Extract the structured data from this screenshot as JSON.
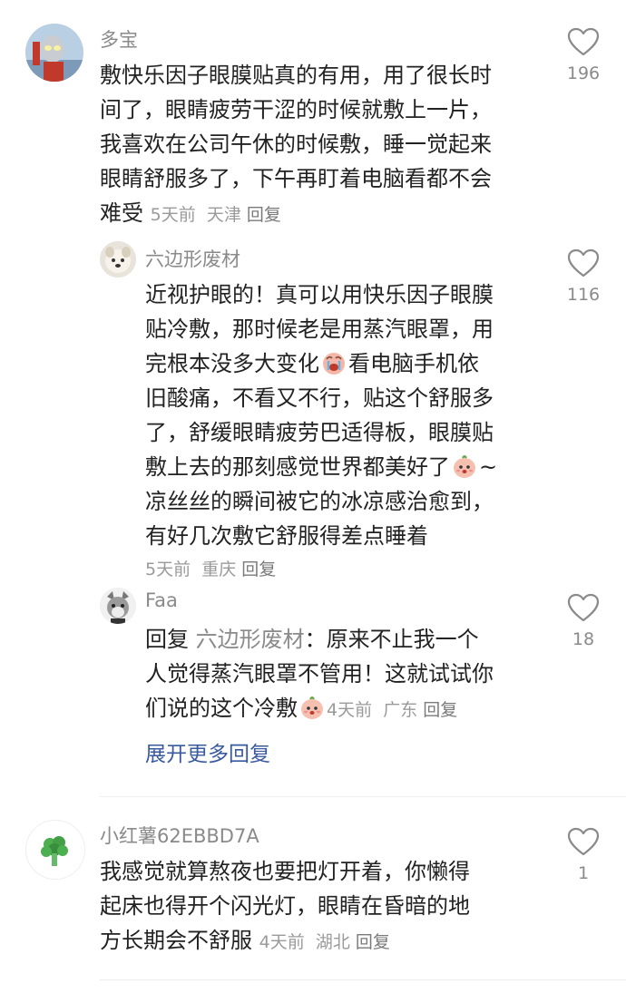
{
  "comments": [
    {
      "username": "多宝",
      "lines": [
        "敷快乐因子眼膜贴真的有用，用了很长时",
        "间了，眼睛疲劳干涩的时候就敷上一片，",
        "我喜欢在公司午休的时候敷，睡一觉起来",
        "眼睛舒服多了，下午再盯着电脑看都不会"
      ],
      "last_line": "难受",
      "time": "5天前",
      "location": "天津",
      "reply_label": "回复",
      "likes": "196"
    },
    {
      "username": "六边形废材",
      "lines": [
        "近视护眼的！真可以用快乐因子眼膜",
        "贴冷敷，那时候老是用蒸汽眼罩，用"
      ],
      "line3a": "完根本没多大变化",
      "line3b": "看电脑手机依",
      "lines2": [
        "旧酸痛，不看又不行，贴这个舒服多",
        "了，舒缓眼睛疲劳巴适得板，眼膜贴"
      ],
      "line6a": "敷上去的那刻感觉世界都美好了",
      "line6b": "~",
      "lines3": [
        "凉丝丝的瞬间被它的冰凉感治愈到，",
        "有好几次敷它舒服得差点睡着"
      ],
      "time": "5天前",
      "location": "重庆",
      "reply_label": "回复",
      "likes": "116"
    },
    {
      "username": "Faa",
      "reply_prefix": "回复",
      "mention": "六边形废材",
      "line1_rest": "：原来不止我一个",
      "line2": "人觉得蒸汽眼罩不管用！这就试试你",
      "line3": "们说的这个冷敷",
      "time": "4天前",
      "location": "广东",
      "reply_label": "回复",
      "likes": "18"
    },
    {
      "username": "小红薯62EBBD7A",
      "lines": [
        "我感觉就算熬夜也要把灯开着，你懒得",
        "起床也得开个闪光灯，眼睛在昏暗的地"
      ],
      "last_line": "方长期会不舒服",
      "time": "4天前",
      "location": "湖北",
      "reply_label": "回复",
      "likes": "1"
    }
  ],
  "expand_replies": "展开更多回复",
  "icons": {
    "like": "heart-outline-icon",
    "emoji": "crying-face-icon",
    "emoji2": "cute-face-icon"
  },
  "colors": {
    "link": "#3a5aa0",
    "meta": "#9a9a9a"
  }
}
